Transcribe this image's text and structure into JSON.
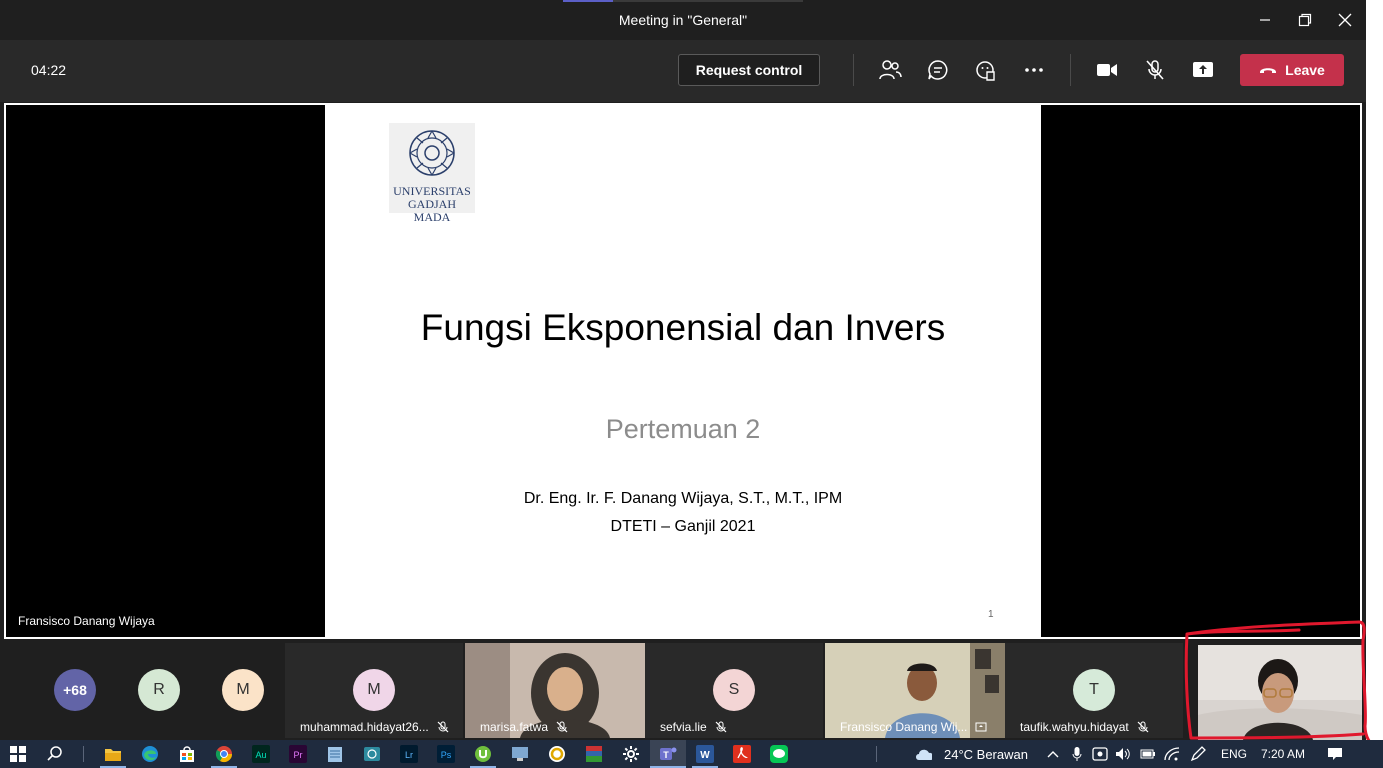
{
  "window": {
    "title": "Meeting in \"General\""
  },
  "toolbar": {
    "timer": "04:22",
    "request_control_label": "Request control",
    "leave_label": "Leave"
  },
  "slide": {
    "logo_text": "UNIVERSITAS\nGADJAH MADA",
    "title": "Fungsi Eksponensial dan Invers",
    "subtitle": "Pertemuan 2",
    "author": "Dr. Eng. Ir. F. Danang Wijaya, S.T., M.T., IPM",
    "term": "DTETI – Ganjil 2021",
    "page_number": "1"
  },
  "presenter_name": "Fransisco Danang Wijaya",
  "participants": {
    "overflow": "+68",
    "r_initial": "R",
    "m_initial": "M",
    "tiles": [
      {
        "initial": "M",
        "name": "muhammad.hidayat26..."
      },
      {
        "initial": "",
        "name": "marisa.fatwa"
      },
      {
        "initial": "S",
        "name": "sefvia.lie"
      },
      {
        "initial": "",
        "name": "Fransisco Danang Wij..."
      },
      {
        "initial": "T",
        "name": "taufik.wahyu.hidayat"
      }
    ]
  },
  "taskbar": {
    "weather": "24°C  Berawan",
    "language": "ENG",
    "time": "7:20 AM"
  },
  "colors": {
    "leave": "#c4314b",
    "teams_accent": "#5b5fc7",
    "annotation": "#e0182d"
  }
}
